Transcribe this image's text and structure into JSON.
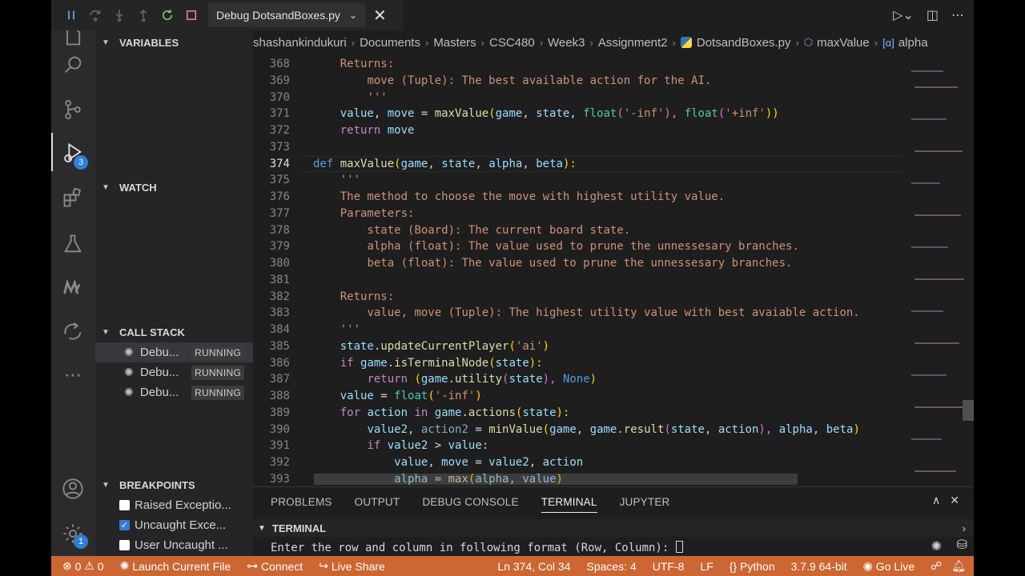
{
  "debug_toolbar": {
    "config_name": "Debug DotsandBoxes.py"
  },
  "activity": {
    "run_debug_badge": "3",
    "accounts_badge": "1"
  },
  "sidebar": {
    "variables_label": "VARIABLES",
    "watch_label": "WATCH",
    "call_stack_label": "CALL STACK",
    "call_stack": [
      {
        "name": "Debu...",
        "status": "RUNNING"
      },
      {
        "name": "Debu...",
        "status": "RUNNING"
      },
      {
        "name": "Debu...",
        "status": "RUNNING"
      }
    ],
    "breakpoints_label": "BREAKPOINTS",
    "breakpoints": [
      {
        "label": "Raised Exceptio...",
        "checked": false
      },
      {
        "label": "Uncaught Exce...",
        "checked": true
      },
      {
        "label": "User Uncaught ...",
        "checked": false
      }
    ]
  },
  "breadcrumb": [
    "shashankindukuri",
    "Documents",
    "Masters",
    "CSC480",
    "Week3",
    "Assignment2",
    "DotsandBoxes.py",
    "maxValue",
    "alpha"
  ],
  "editor": {
    "line_numbers": [
      "368",
      "369",
      "370",
      "371",
      "372",
      "373",
      "374",
      "375",
      "376",
      "377",
      "378",
      "379",
      "380",
      "381",
      "382",
      "383",
      "384",
      "385",
      "386",
      "387",
      "388",
      "389",
      "390",
      "391",
      "392",
      "393"
    ],
    "active_line": "374",
    "lines": {
      "l368": "Returns:",
      "l369": "move (Tuple): The best available action for the AI.",
      "l370": "'''",
      "l371": [
        "value",
        ", ",
        "move",
        " = ",
        "maxValue",
        "(",
        "game",
        ", ",
        "state",
        ", ",
        "float",
        "(",
        "'-inf'",
        "), ",
        "float",
        "(",
        "'+inf'",
        "))"
      ],
      "l372": [
        "return",
        " ",
        "move"
      ],
      "l374": [
        "def",
        " ",
        "maxValue",
        "(",
        "game",
        ", ",
        "state",
        ", ",
        "alpha",
        ", ",
        "beta",
        "):"
      ],
      "l375": "'''",
      "l376": "The method to choose the move with highest utility value.",
      "l377": "Parameters:",
      "l378": "state (Board): The current board state.",
      "l379": "alpha (float): The value used to prune the unnessesary branches.",
      "l380": "beta (float): The value used to prune the unnessesary branches.",
      "l382": "Returns:",
      "l383": "value, move (Tuple): The highest utility value with best avaiable action.",
      "l384": "'''",
      "l385": [
        "state",
        ".",
        "updateCurrentPlayer",
        "(",
        "'ai'",
        ")"
      ],
      "l386": [
        "if",
        " ",
        "game",
        ".",
        "isTerminalNode",
        "(",
        "state",
        "):"
      ],
      "l387": [
        "return",
        " (",
        "game",
        ".",
        "utility",
        "(",
        "state",
        "), ",
        "None",
        ")"
      ],
      "l388": [
        "value",
        " = ",
        "float",
        "(",
        "'-inf'",
        ")"
      ],
      "l389": [
        "for",
        " ",
        "action",
        " ",
        "in",
        " ",
        "game",
        ".",
        "actions",
        "(",
        "state",
        "):"
      ],
      "l390": [
        "value2",
        ", ",
        "action2",
        " = ",
        "minValue",
        "(",
        "game",
        ", ",
        "game",
        ".",
        "result",
        "(",
        "state",
        ", ",
        "action",
        "), ",
        "alpha",
        ", ",
        "beta",
        ")"
      ],
      "l391": [
        "if",
        " ",
        "value2",
        " > ",
        "value",
        ":"
      ],
      "l392": [
        "value",
        ", ",
        "move",
        " = ",
        "value2",
        ", ",
        "action"
      ],
      "l393": [
        "alpha",
        " = ",
        "max",
        "(",
        "alpha",
        ", ",
        "value",
        ")"
      ]
    }
  },
  "panel": {
    "tabs": [
      "PROBLEMS",
      "OUTPUT",
      "DEBUG CONSOLE",
      "TERMINAL",
      "JUPYTER"
    ],
    "active_tab": "TERMINAL",
    "terminal_label": "TERMINAL",
    "terminal_prompt": "Enter the row and column in following format (Row, Column): "
  },
  "statusbar": {
    "errors": "0",
    "warnings": "0",
    "launch": "Launch Current File",
    "connect": "Connect",
    "live_share": "Live Share",
    "position": "Ln 374, Col 34",
    "spaces": "Spaces: 4",
    "encoding": "UTF-8",
    "eol": "LF",
    "language": "Python",
    "interpreter": "3.7.9 64-bit",
    "go_live": "Go Live"
  },
  "colors": {
    "status_bar": "#cc6633",
    "keyword": "#569cd6",
    "control_keyword": "#c586c0",
    "function": "#dcdcaa",
    "variable": "#9cdcfe",
    "string": "#ce9178"
  }
}
